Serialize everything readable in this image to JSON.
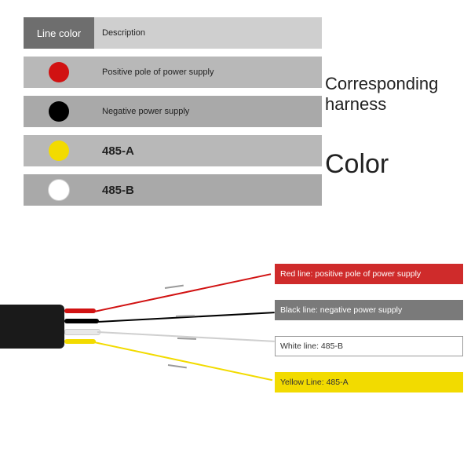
{
  "table": {
    "header": {
      "left": "Line color",
      "right": "Description"
    },
    "rows": [
      {
        "color": "#d11212",
        "name": "Red",
        "desc": "Positive pole of power supply"
      },
      {
        "color": "#000000",
        "name": "Black",
        "desc": "Negative power supply"
      },
      {
        "color": "#f2db00",
        "name": "Yellow",
        "desc": "485-A"
      },
      {
        "color": "#ffffff",
        "name": "White",
        "desc": "485-B"
      }
    ]
  },
  "side_text": {
    "line1": "Corresponding",
    "line2": "harness",
    "line3": "Color"
  },
  "wires": {
    "red": {
      "color": "#d11212",
      "label": "Red line: positive pole of power supply",
      "label_bg": "#cf2b2b",
      "label_border": "#cf2b2b",
      "label_fg": "#ffffff"
    },
    "black": {
      "color": "#000000",
      "label": "Black line: negative power supply",
      "label_bg": "#7a7a7a",
      "label_border": "#7a7a7a",
      "label_fg": "#ffffff"
    },
    "white": {
      "color": "#e8e8e8",
      "label": "White line: 485-B",
      "label_bg": "#ffffff",
      "label_border": "#9a9a9a",
      "label_fg": "#333333"
    },
    "yellow": {
      "color": "#f2db00",
      "label": "Yellow Line: 485-A",
      "label_bg": "#f2db00",
      "label_border": "#f2db00",
      "label_fg": "#333333"
    }
  }
}
